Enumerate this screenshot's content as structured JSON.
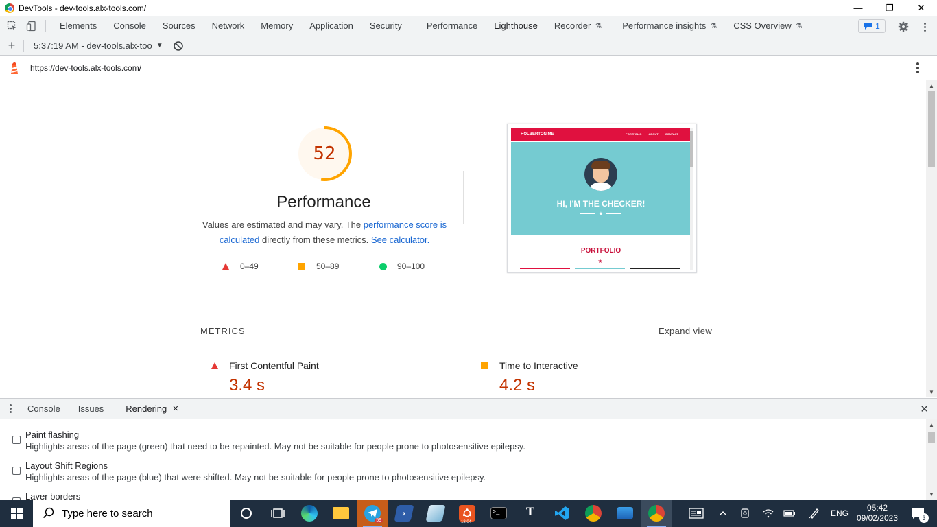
{
  "window": {
    "title": "DevTools - dev-tools.alx-tools.com/",
    "minimize": "—",
    "restore": "❐",
    "close": "✕"
  },
  "devtools_tabs": [
    "Elements",
    "Console",
    "Sources",
    "Network",
    "Memory",
    "Application",
    "Security",
    "Performance",
    "Lighthouse",
    "Recorder",
    "Performance insights",
    "CSS Overview"
  ],
  "active_tab": "Lighthouse",
  "issues_badge": "1",
  "report_toolbar": {
    "add": "+",
    "report_select": "5:37:19 AM - dev-tools.alx-too",
    "caret": "▼"
  },
  "url": "https://dev-tools.alx-tools.com/",
  "score": {
    "value": 52,
    "fraction": 0.52,
    "color": "#ffa400",
    "title": "Performance",
    "desc_part1": "Values are estimated and may vary. The ",
    "link1": "performance score is calculated",
    "desc_part2": " directly from these metrics. ",
    "link2": "See calculator."
  },
  "legend": {
    "fail": "0–49",
    "average": "50–89",
    "pass": "90–100"
  },
  "screenshot": {
    "brand": "HOLBERTON ME",
    "nav_links": [
      "PORTFOLIO",
      "ABOUT",
      "CONTACT"
    ],
    "hero_text": "HI, I'M THE CHECKER!",
    "section": "PORTFOLIO",
    "star": "★"
  },
  "metrics": {
    "heading": "METRICS",
    "expand": "Expand view",
    "items": [
      {
        "label": "First Contentful Paint",
        "value": "3.4 s"
      },
      {
        "label": "Time to Interactive",
        "value": "4.2 s"
      }
    ]
  },
  "drawer": {
    "tabs": [
      "Console",
      "Issues",
      "Rendering"
    ],
    "active": "Rendering",
    "tab_close": "✕",
    "close": "✕",
    "options": [
      {
        "title": "Paint flashing",
        "desc": "Highlights areas of the page (green) that need to be repainted. May not be suitable for people prone to photosensitive epilepsy."
      },
      {
        "title": "Layout Shift Regions",
        "desc": "Highlights areas of the page (blue) that were shifted. May not be suitable for people prone to photosensitive epilepsy."
      },
      {
        "title": "Layer borders",
        "desc": ""
      }
    ]
  },
  "taskbar": {
    "search_placeholder": "Type here to search",
    "telegram_badge": "59",
    "ubuntu_badge": "18.04",
    "language": "ENG",
    "time": "05:42",
    "date": "09/02/2023",
    "notifications": "3"
  },
  "colors": {
    "accent": "#1a73e8",
    "fail": "#e53935",
    "average": "#ffa400",
    "pass": "#0cce6b",
    "score_text": "#c33300"
  }
}
